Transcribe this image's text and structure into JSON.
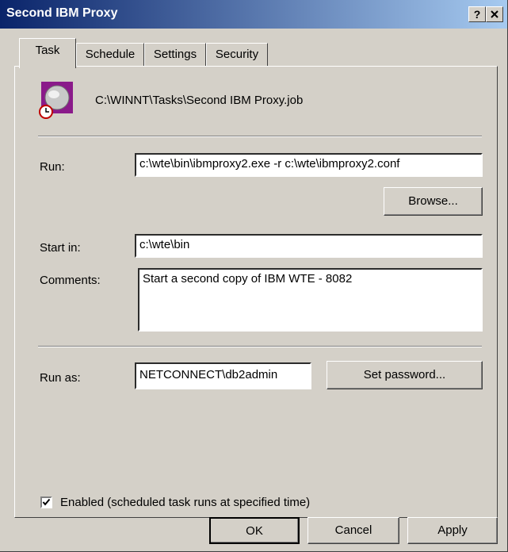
{
  "window": {
    "title": "Second IBM Proxy",
    "help_button": "?",
    "close_button": "X"
  },
  "tabs": [
    {
      "label": "Task",
      "active": true
    },
    {
      "label": "Schedule",
      "active": false
    },
    {
      "label": "Settings",
      "active": false
    },
    {
      "label": "Security",
      "active": false
    }
  ],
  "task": {
    "icon": "scheduled-task-icon",
    "file_path": "C:\\WINNT\\Tasks\\Second IBM Proxy.job",
    "run_label": "Run:",
    "run_value": "c:\\wte\\bin\\ibmproxy2.exe -r c:\\wte\\ibmproxy2.conf",
    "browse_label": "Browse...",
    "start_in_label": "Start in:",
    "start_in_value": "c:\\wte\\bin",
    "comments_label": "Comments:",
    "comments_value": "Start a second copy of IBM WTE - 8082",
    "run_as_label": "Run as:",
    "run_as_value": "NETCONNECT\\db2admin",
    "set_password_label": "Set password...",
    "enabled_label": "Enabled (scheduled task runs at specified time)",
    "enabled_checked": true
  },
  "footer": {
    "ok": "OK",
    "cancel": "Cancel",
    "apply": "Apply"
  },
  "colors": {
    "titlebar_start": "#0a246a",
    "titlebar_end": "#a6caf0",
    "face": "#d4d0c8"
  }
}
